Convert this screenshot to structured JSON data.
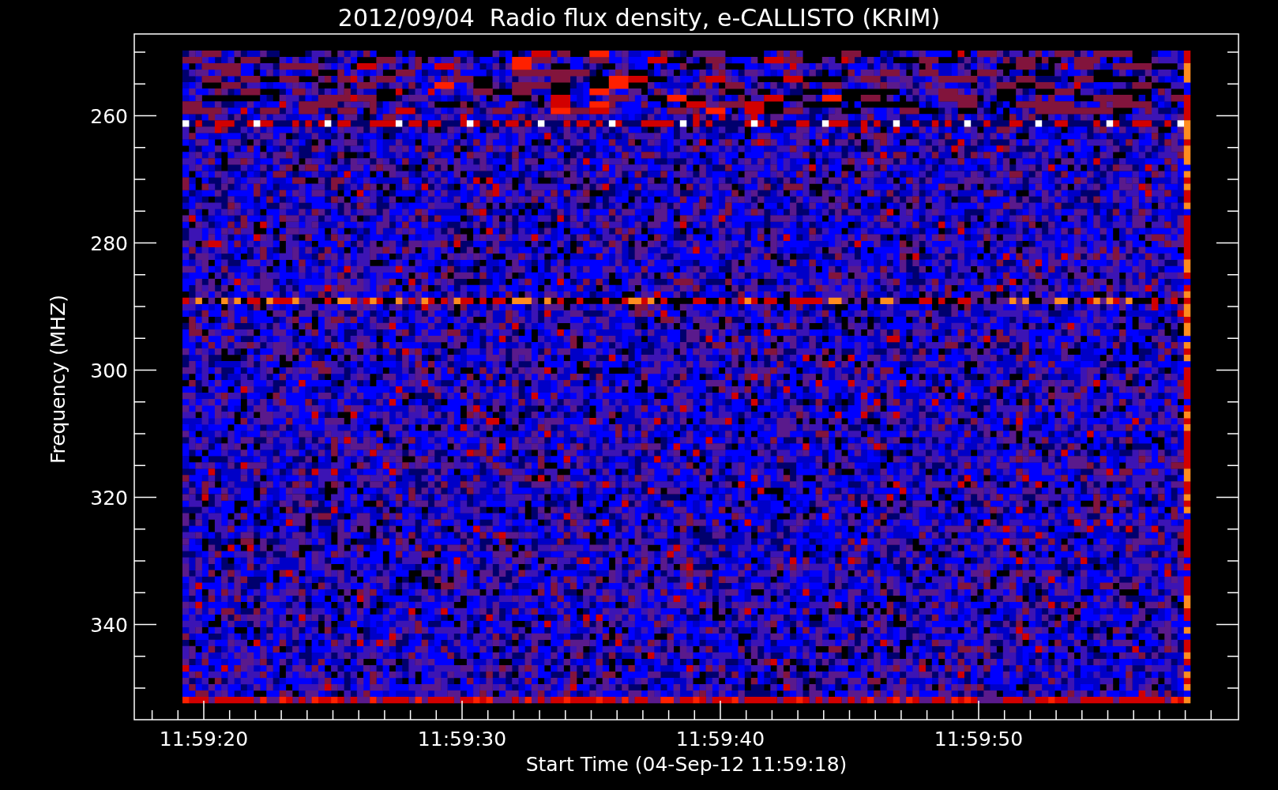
{
  "title": "2012/09/04  Radio flux density, e-CALLISTO (KRIM)",
  "ylabel": "Frequency (MHZ)",
  "xlabel": "Start Time (04-Sep-12 11:59:18)",
  "yticks": [
    "260",
    "280",
    "300",
    "320",
    "340"
  ],
  "xticks": [
    "11:59:20",
    "11:59:30",
    "11:59:40",
    "11:59:50"
  ]
}
